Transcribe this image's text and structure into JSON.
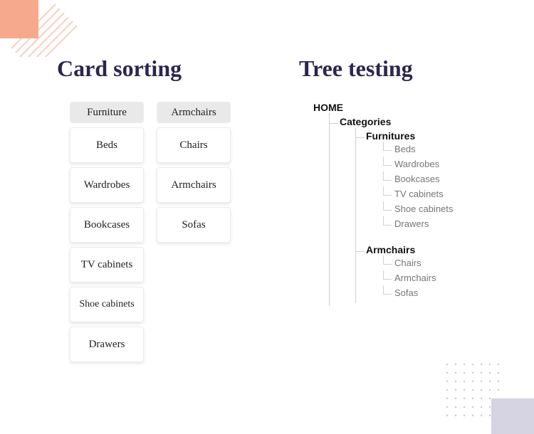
{
  "left": {
    "title": "Card sorting",
    "groups": [
      {
        "header": "Furniture",
        "cards": [
          "Beds",
          "Wardrobes",
          "Bookcases",
          "TV cabinets",
          "Shoe cabinets",
          "Drawers"
        ]
      },
      {
        "header": "Armchairs",
        "cards": [
          "Chairs",
          "Armchairs",
          "Sofas"
        ]
      }
    ]
  },
  "right": {
    "title": "Tree testing",
    "tree": {
      "root": "HOME",
      "categories_label": "Categories",
      "branches": [
        {
          "label": "Furnitures",
          "leaves": [
            "Beds",
            "Wardrobes",
            "Bookcases",
            "TV cabinets",
            "Shoe cabinets",
            "Drawers"
          ]
        },
        {
          "label": "Armchairs",
          "leaves": [
            "Chairs",
            "Armchairs",
            "Sofas"
          ]
        }
      ]
    }
  },
  "colors": {
    "heading": "#2c2550",
    "peach": "#f6a98d",
    "lavender": "#d6d4e2"
  }
}
